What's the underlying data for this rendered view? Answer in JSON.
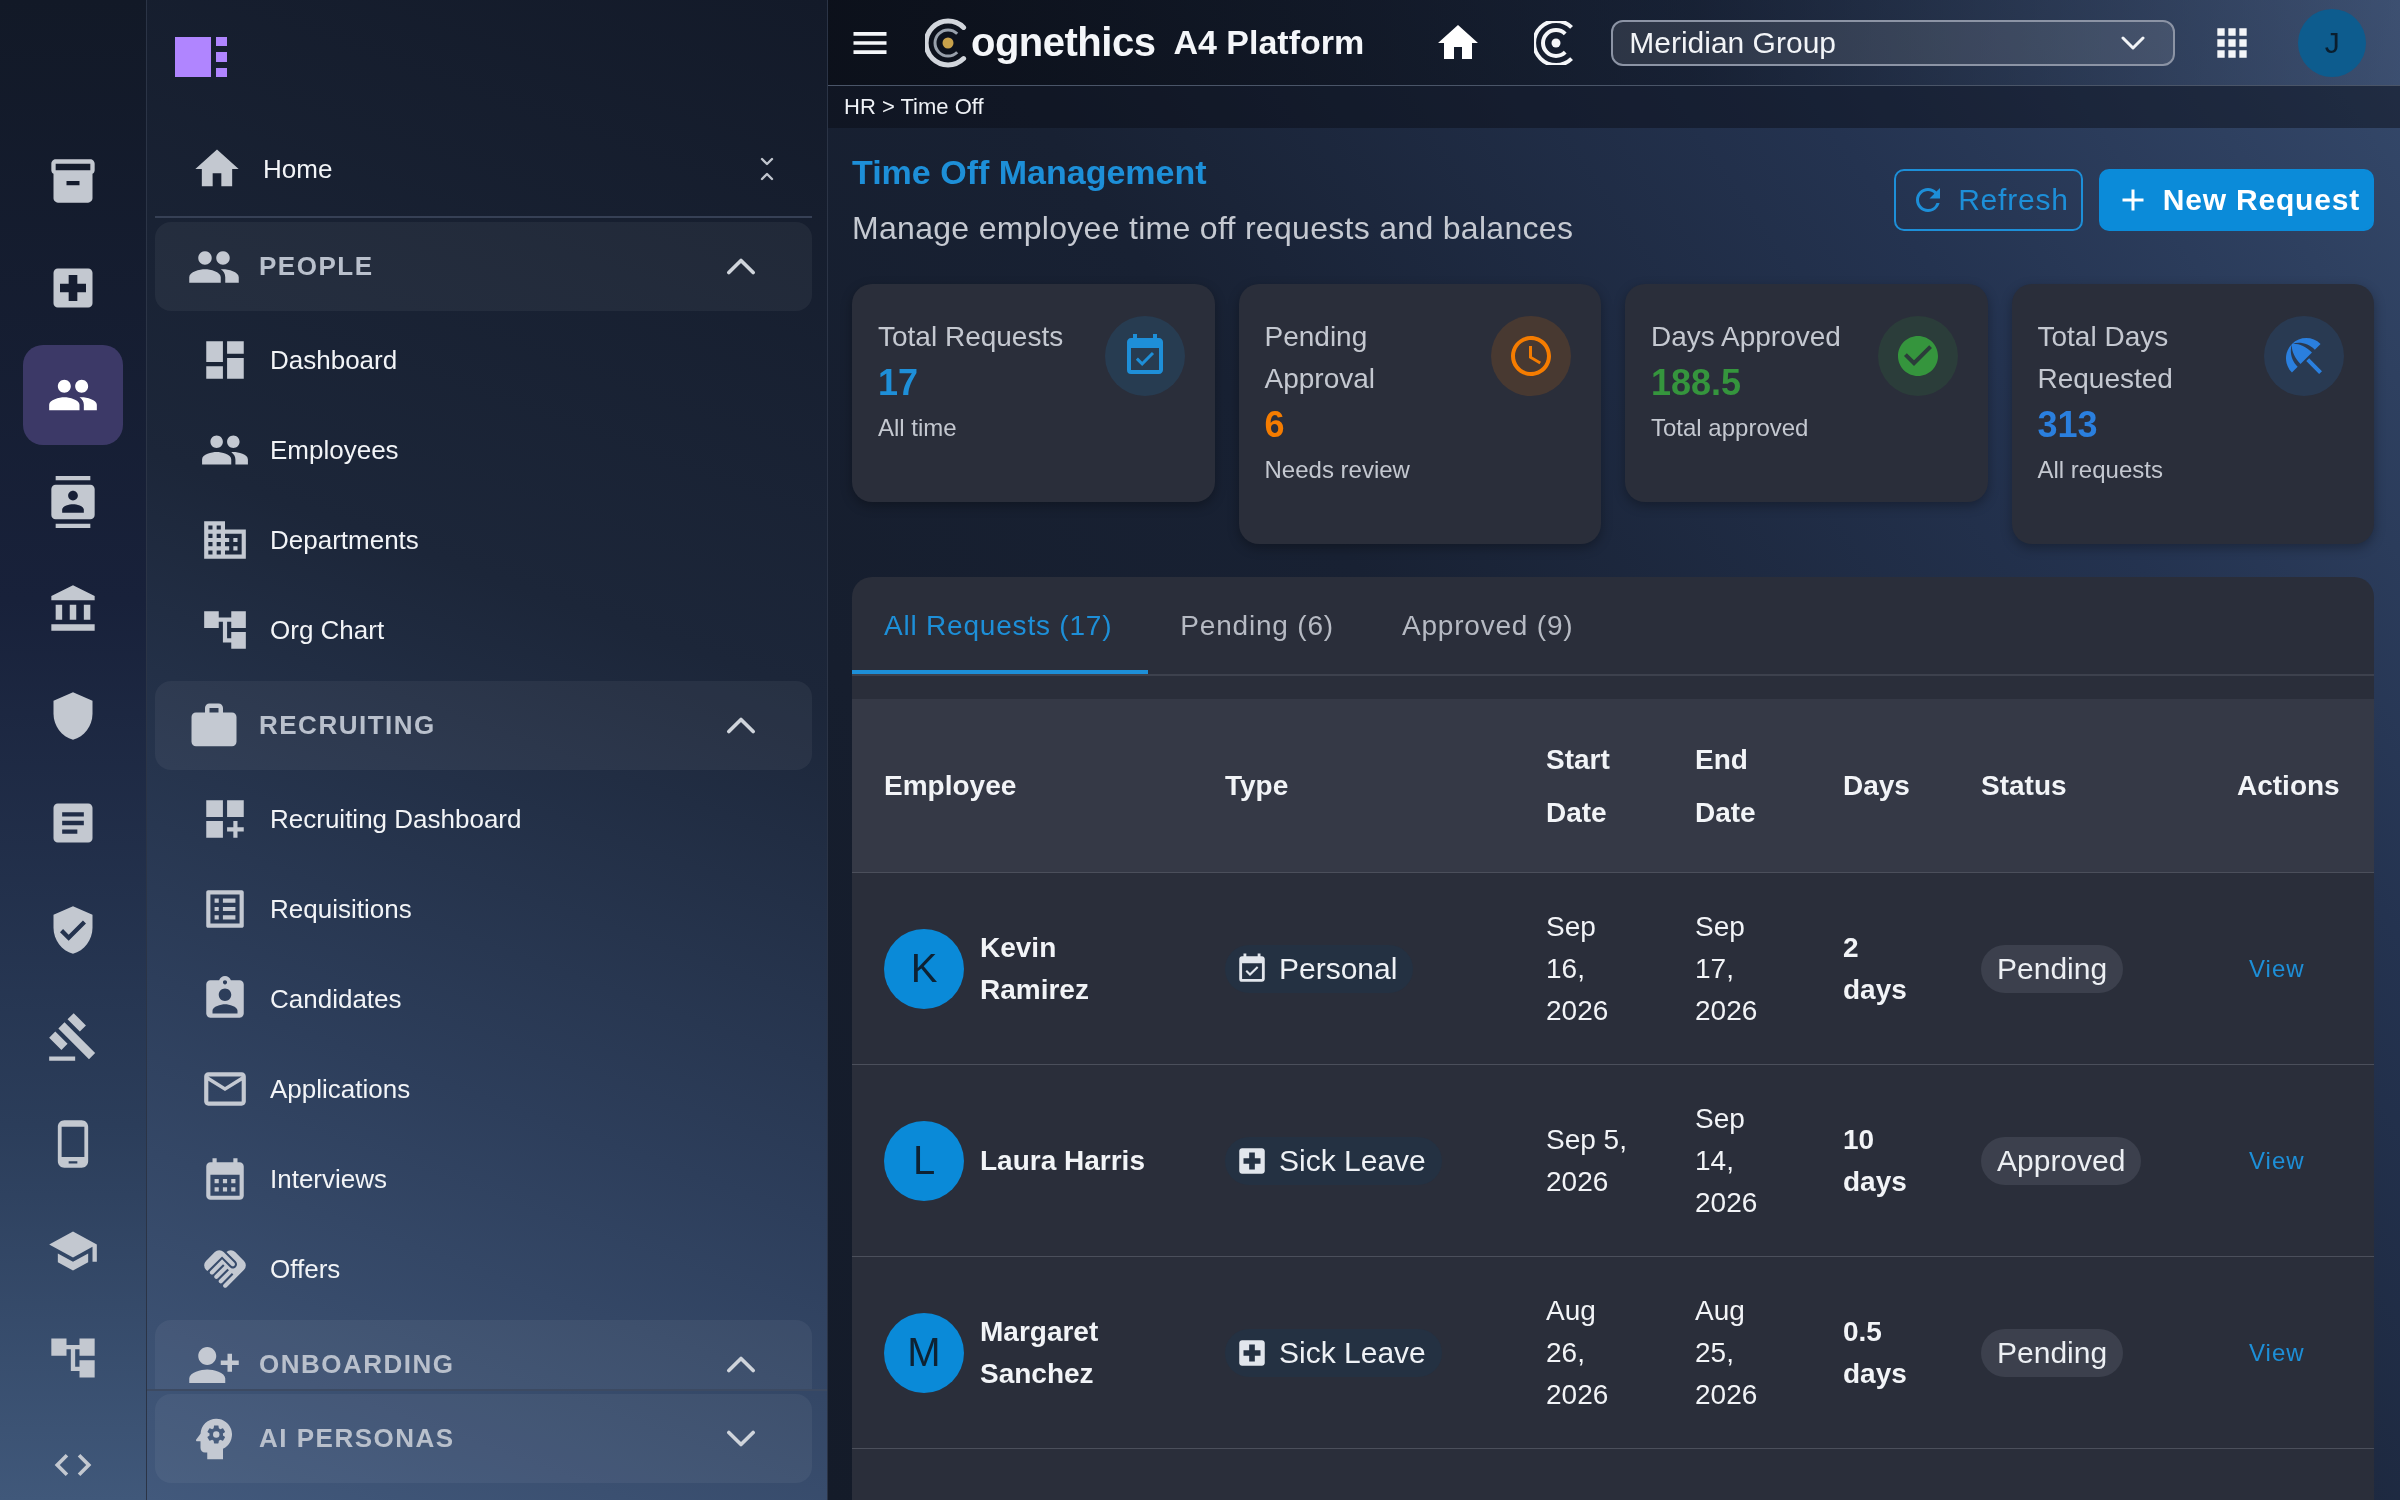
{
  "rail": {
    "items": [
      {
        "selected": false
      },
      {
        "selected": false
      },
      {
        "selected": true
      },
      {
        "selected": false
      },
      {
        "selected": false
      },
      {
        "selected": false
      },
      {
        "selected": false
      },
      {
        "selected": false
      },
      {
        "selected": false
      },
      {
        "selected": false
      },
      {
        "selected": false
      },
      {
        "selected": false
      },
      {
        "selected": false
      }
    ]
  },
  "sidebar": {
    "home": {
      "label": "Home"
    },
    "groups": [
      {
        "label": "PEOPLE",
        "expanded": true,
        "items": [
          {
            "label": "Dashboard"
          },
          {
            "label": "Employees"
          },
          {
            "label": "Departments"
          },
          {
            "label": "Org Chart"
          }
        ]
      },
      {
        "label": "RECRUITING",
        "expanded": true,
        "items": [
          {
            "label": "Recruiting Dashboard"
          },
          {
            "label": "Requisitions"
          },
          {
            "label": "Candidates"
          },
          {
            "label": "Applications"
          },
          {
            "label": "Interviews"
          },
          {
            "label": "Offers"
          }
        ]
      },
      {
        "label": "ONBOARDING",
        "expanded": true
      }
    ],
    "pinned_group": {
      "label": "AI PERSONAS",
      "expanded": false
    }
  },
  "topbar": {
    "brand": "ognethics",
    "product": "A4 Platform",
    "organization_select": {
      "value": "Meridian Group"
    },
    "avatar": {
      "initial": "J"
    }
  },
  "breadcrumb": "HR > Time Off",
  "page": {
    "title": "Time Off Management",
    "subtitle": "Manage employee time off requests and balances",
    "buttons": [
      {
        "label": "Refresh",
        "kind": "outlined"
      },
      {
        "label": "New Request",
        "kind": "primary"
      }
    ]
  },
  "stats": [
    {
      "label": "Total Requests",
      "value": "17",
      "caption": "All time",
      "color": "#1e8fd8"
    },
    {
      "label": "Pending Approval",
      "value": "6",
      "caption": "Needs review",
      "color": "#f57c00"
    },
    {
      "label": "Days Approved",
      "value": "188.5",
      "caption": "Total approved",
      "color": "#35953d"
    },
    {
      "label": "Total Days Requested",
      "value": "313",
      "caption": "All requests",
      "color": "#2a7fde"
    }
  ],
  "tabs": [
    {
      "label": "All Requests (17)",
      "selected": true
    },
    {
      "label": "Pending (6)",
      "selected": false
    },
    {
      "label": "Approved (9)",
      "selected": false
    }
  ],
  "table": {
    "columns": [
      "Employee",
      "Type",
      "Start Date",
      "End Date",
      "Days",
      "Status",
      "Actions"
    ],
    "rows": [
      {
        "employee": {
          "name": "Kevin Ramirez",
          "initial": "K"
        },
        "type": {
          "label": "Personal",
          "kind": "personal"
        },
        "start_date": "Sep 16, 2026",
        "end_date": "Sep 17, 2026",
        "days": "2 days",
        "status": "Pending",
        "action": "View"
      },
      {
        "employee": {
          "name": "Laura Harris",
          "initial": "L"
        },
        "type": {
          "label": "Sick Leave",
          "kind": "sick_leave"
        },
        "start_date": "Sep 5, 2026",
        "end_date": "Sep 14, 2026",
        "days": "10 days",
        "status": "Approved",
        "action": "View"
      },
      {
        "employee": {
          "name": "Margaret Sanchez",
          "initial": "M"
        },
        "type": {
          "label": "Sick Leave",
          "kind": "sick_leave"
        },
        "start_date": "Aug 26, 2026",
        "end_date": "Aug 25, 2026",
        "days": "0.5 days",
        "status": "Pending",
        "action": "View"
      }
    ]
  }
}
